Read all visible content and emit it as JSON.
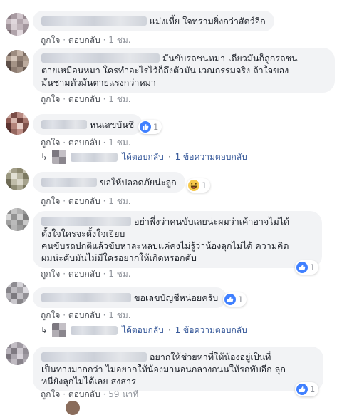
{
  "actions": {
    "like": "ถูกใจ",
    "reply": "ตอบกลับ",
    "dot": "·"
  },
  "comments": [
    {
      "text_lines": [
        "แม่งเหี้ย ใจทรามยิ่งกว่าสัตว์อีก"
      ],
      "time": "1 ชม."
    },
    {
      "text_lines": [
        "มันขับรถชนหมา เดียวมันก็ถูกรถชน",
        "ตายเหมือนหมา ใครทำอะไรไว้ก็ถึงตัวมัน เวณกรรมจริง ถ้าใจของ",
        "มันชามตัวมันตายแรงกว่าหมา"
      ],
      "time": "1 ชม."
    },
    {
      "text_lines": [
        "หนเลขบันชี"
      ],
      "time": "1 ชม.",
      "reaction": {
        "type": "like",
        "count": "1"
      },
      "reply_summary": {
        "replied": "ได้ตอบกลับ",
        "count": "1 ข้อความตอบกลับ"
      }
    },
    {
      "text_lines": [
        "ขอให้ปลอดภัยน่ะลูก"
      ],
      "time": "1 ชม.",
      "reaction": {
        "type": "haha",
        "count": "1"
      }
    },
    {
      "text_lines": [
        "อย่าพึ่งว่าคนขับเลยน่ะผมว่าเค้าอาจไม่ได้",
        "ตั้งใจใครจะตั้งใจเยียบ",
        "คนขับรถปกติแล้วขับหาละหลบแค่คงไม่รู้ว่าน้องลุกไม่ได้ ความคิด",
        "ผมน่ะคับมันไม่มีใครอยากให้เกิดหรอกคับ"
      ],
      "time": "1 ชม.",
      "reaction": {
        "type": "like",
        "count": "1"
      }
    },
    {
      "text_lines": [
        "ขอเลขบัญชีหน่อยครับ"
      ],
      "time": "1 ชม.",
      "reaction": {
        "type": "like",
        "count": "1"
      },
      "reply_summary": {
        "replied": "ได้ตอบกลับ",
        "count": "1 ข้อความตอบกลับ"
      }
    },
    {
      "text_lines": [
        "อยากให้ช่วยหาที่ให้น้องอยู่เป็นที่",
        "เป็นทางมากกว่า ไม่อยากให้น้องมานอนกลางถนนให้รถทับอีก ลุก",
        "หนียังลุกไม่ได้เลย สงสาร"
      ],
      "time": "59 นาที",
      "reaction": {
        "type": "like",
        "count": "1"
      }
    }
  ]
}
